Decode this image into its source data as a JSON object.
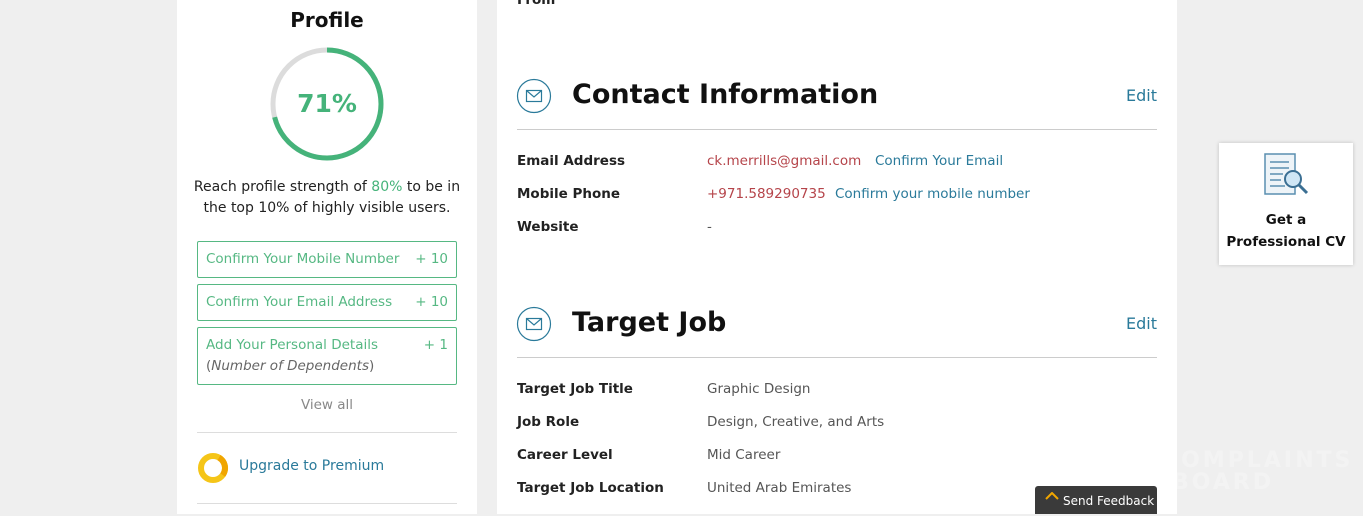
{
  "sidebar": {
    "title": "Profile",
    "progress_percent": 71,
    "progress_label": "71%",
    "reach_prefix": "Reach profile strength of ",
    "reach_target": "80%",
    "reach_suffix": " to be in the top 10% of highly visible users.",
    "tasks": [
      {
        "label": "Confirm Your Mobile Number",
        "points": "+ 10"
      },
      {
        "label": "Confirm Your Email Address",
        "points": "+ 10"
      },
      {
        "label": "Add Your Personal Details",
        "points": "+ 1",
        "sub_open": "(",
        "sub_italic": "Number of Dependents",
        "sub_close": ")"
      }
    ],
    "view_all": "View all",
    "premium_label": "Upgrade to Premium"
  },
  "main": {
    "from_label": "From",
    "contact": {
      "title": "Contact Information",
      "edit": "Edit",
      "rows": [
        {
          "label": "Email Address",
          "value": "ck.merrills@gmail.com",
          "action": "Confirm Your Email"
        },
        {
          "label": "Mobile Phone",
          "value": "+971.589290735",
          "action": "Confirm your mobile number"
        },
        {
          "label": "Website",
          "value": "-"
        }
      ]
    },
    "target_job": {
      "title": "Target Job",
      "edit": "Edit",
      "rows": [
        {
          "label": "Target Job Title",
          "value": "Graphic Design"
        },
        {
          "label": "Job Role",
          "value": "Design, Creative, and Arts"
        },
        {
          "label": "Career Level",
          "value": "Mid Career"
        },
        {
          "label": "Target Job Location",
          "value": "United Arab Emirates"
        }
      ]
    }
  },
  "cv_card": {
    "line1": "Get a",
    "line2": "Professional CV",
    "icon": "document-magnifier-icon"
  },
  "watermark": {
    "line1": "COMPLAINTS",
    "line2": "BOARD"
  },
  "feedback": {
    "label": "Send Feedback",
    "icon": "chevron-up-icon"
  },
  "colors": {
    "accent_green": "#45b37a",
    "link_blue": "#2a7a9a",
    "value_red": "#b5444a",
    "premium_yellow": "#f5c518"
  }
}
